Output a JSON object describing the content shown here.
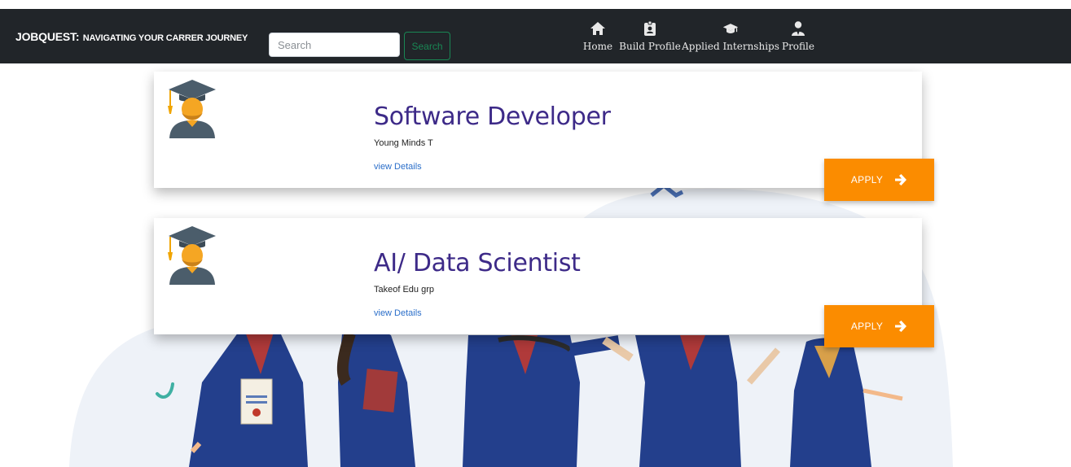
{
  "navbar": {
    "brand_main": "JOBQUEST:",
    "brand_sub": "NAVIGATING YOUR CARRER JOURNEY",
    "search_placeholder": "Search",
    "search_button": "Search",
    "items": [
      {
        "label": "Home",
        "icon": "home-icon"
      },
      {
        "label": "Build Profile",
        "icon": "id-badge-icon"
      },
      {
        "label": "Applied Internships",
        "icon": "graduation-cap-icon"
      },
      {
        "label": "Profile",
        "icon": "user-tie-icon"
      }
    ]
  },
  "jobs": [
    {
      "title": "Software Developer",
      "company": "Young Minds T",
      "details_link": "view Details",
      "apply_label": "APPLY"
    },
    {
      "title": "AI/ Data Scientist",
      "company": "Takeof Edu grp",
      "details_link": "view Details",
      "apply_label": "APPLY"
    }
  ],
  "colors": {
    "navbar_bg": "#212529",
    "title": "#3d2a88",
    "apply": "#fb8c00",
    "search_button": "#198754",
    "link": "#2a6ec9"
  }
}
